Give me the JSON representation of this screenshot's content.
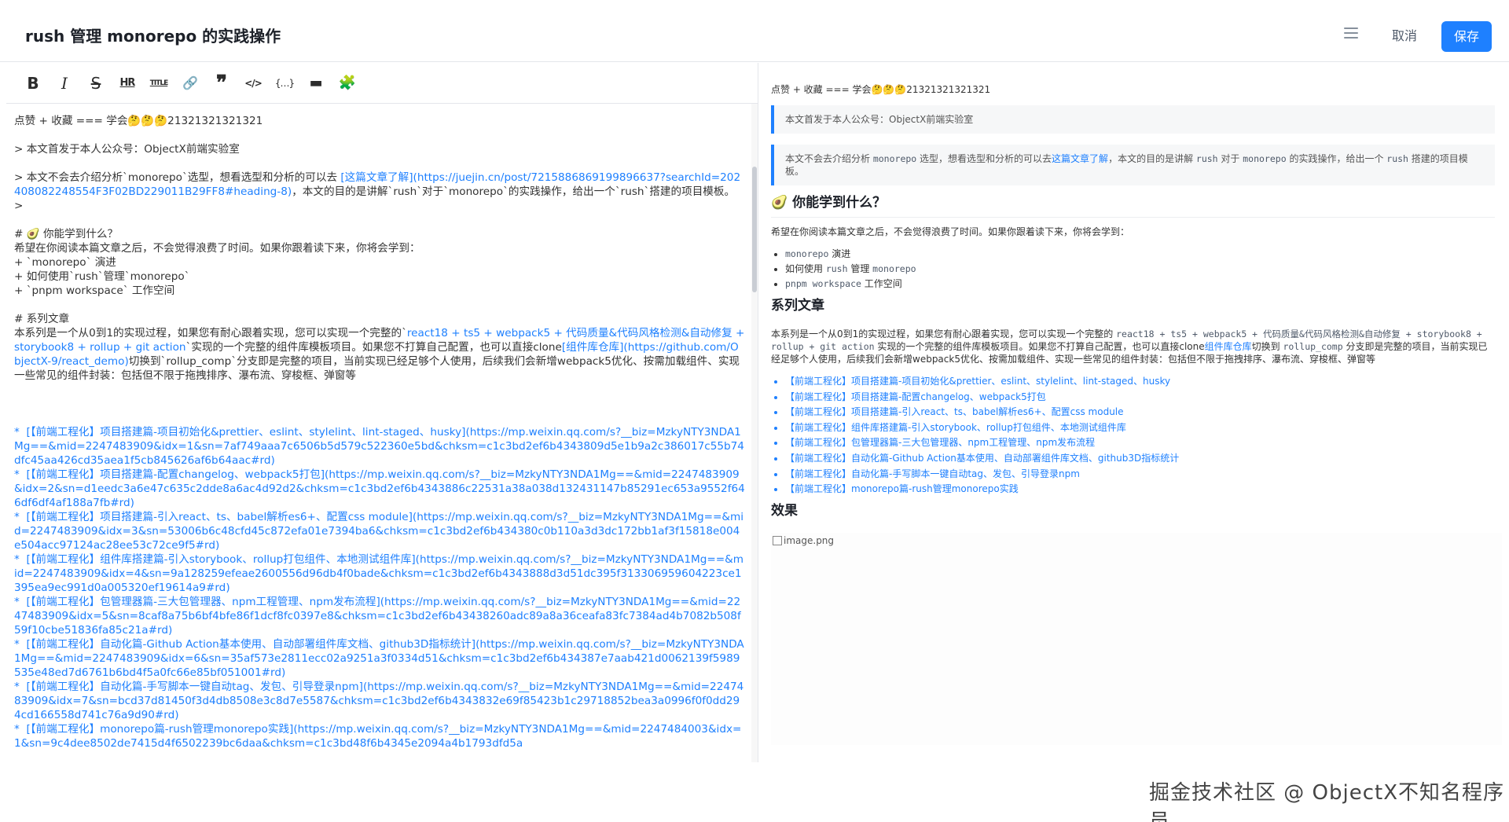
{
  "header": {
    "title": "rush 管理 monorepo 的实践操作",
    "menu_icon": "hamburger-menu-icon",
    "cancel_label": "取消",
    "save_label": "保存",
    "accent_color": "#1e80ff"
  },
  "toolbar": {
    "items": [
      {
        "name": "bold",
        "glyph": "B"
      },
      {
        "name": "italic",
        "glyph": "I"
      },
      {
        "name": "strikethrough",
        "glyph": "S"
      },
      {
        "name": "horizontal-rule",
        "glyph": "HR"
      },
      {
        "name": "title",
        "glyph": "TITLE"
      },
      {
        "name": "link",
        "glyph": "🔗"
      },
      {
        "name": "quote",
        "glyph": "❞"
      },
      {
        "name": "code",
        "glyph": "</>"
      },
      {
        "name": "code-block",
        "glyph": "{…}"
      },
      {
        "name": "image",
        "glyph": "▬"
      },
      {
        "name": "plugin",
        "glyph": "🧩"
      }
    ]
  },
  "editor": {
    "line1": "点赞 + 收藏 === 学会🤔🤔🤔21321321321321",
    "line2": "> 本文首发于本人公众号：ObjectX前端实验室",
    "line3a": "> 本文不会去介绍分析`monorepo`选型，想看选型和分析的可以去 ",
    "line3link": "[这篇文章了解](https://juejin.cn/post/7215886869199896637?searchId=202408082248554F3F02BD229011B29FF8#heading-8)",
    "line3b": "，本文的目的是讲解`rush`对于`monorepo`的实践操作，给出一个`rush`搭建的项目模板。",
    "line4": ">",
    "line5": "# 🥑 你能学到什么？",
    "line6": "希望在你阅读本篇文章之后，不会觉得浪费了时间。如果你跟着读下来，你将会学到：",
    "line7": "+ `monorepo` 演进",
    "line8": "+ 如何使用`rush`管理`monorepo`",
    "line9": "+ `pnpm workspace` 工作空间",
    "line10": "# 系列文章",
    "line11a": "本系列是一个从0到1的实现过程，如果您有耐心跟着实现，您可以实现一个完整的`",
    "line11link": "react18 + ts5 + webpack5 + 代码质量&代码风格检测&自动修复 + storybook8 + rollup + git action",
    "line11b": "`实现的一个完整的组件库模板项目。如果您不打算自己配置，也可以直接clone",
    "line11link2": "[组件库仓库](https://github.com/ObjectX-9/react_demo)",
    "line11c": "切换到`rollup_comp`分支即是完整的项目，当前实现已经足够个人使用，后续我们会新增webpack5优化、按需加载组件、实现一些常见的组件封装：包括但不限于拖拽排序、瀑布流、穿梭框、弹窗等",
    "series": [
      "*  [【前端工程化】项目搭建篇-项目初始化&prettier、eslint、stylelint、lint-staged、husky](https://mp.weixin.qq.com/s?__biz=MzkyNTY3NDA1Mg==&mid=2247483909&idx=1&sn=7af749aaa7c6506b5d579c522360e5bd&chksm=c1c3bd2ef6b4343809d5e1b9a2c386017c55b74dfc45aa426cd35aea1f5cb845626af6b64aac#rd)",
      "*  [【前端工程化】项目搭建篇-配置changelog、webpack5打包](https://mp.weixin.qq.com/s?__biz=MzkyNTY3NDA1Mg==&mid=2247483909&idx=2&sn=d1eedc3a6e47c635c2dde8a6ac4d92d2&chksm=c1c3bd2ef6b4343886c22531a38a038d132431147b85291ec653a9552f646df6df4af188a7fb#rd)",
      "*  [【前端工程化】项目搭建篇-引入react、ts、babel解析es6+、配置css module](https://mp.weixin.qq.com/s?__biz=MzkyNTY3NDA1Mg==&mid=2247483909&idx=3&sn=53006b6c48cfd45c872efa01e7394ba6&chksm=c1c3bd2ef6b434380c0b110a3d3dc172bb1af3f15818e004e504acc97124ac28ee53c72ce9f5#rd)",
      "*  [【前端工程化】组件库搭建篇-引入storybook、rollup打包组件、本地测试组件库](https://mp.weixin.qq.com/s?__biz=MzkyNTY3NDA1Mg==&mid=2247483909&idx=4&sn=9a128259efeae2600556d96db4f0bade&chksm=c1c3bd2ef6b4343888d3d51dc395f313306959604223ce1395ea9ec991d0a005320ef19614a9#rd)",
      "*  [【前端工程化】包管理器篇-三大包管理器、npm工程管理、npm发布流程](https://mp.weixin.qq.com/s?__biz=MzkyNTY3NDA1Mg==&mid=2247483909&idx=5&sn=8caf8a75b6bf4bfe86f1dcf8fc0397e8&chksm=c1c3bd2ef6b43438260adc89a8a36ceafa83fc7384ad4b7082b508f59f10cbe51836fa85c21a#rd)",
      "*  [【前端工程化】自动化篇-Github Action基本使用、自动部署组件库文档、github3D指标统计](https://mp.weixin.qq.com/s?__biz=MzkyNTY3NDA1Mg==&mid=2247483909&idx=6&sn=35af573e2811ecc02a9251a3f0334d51&chksm=c1c3bd2ef6b434387e7aab421d0062139f5989535e48ed7d6761b6bd4f5a0fc66e85bf051001#rd)",
      "*  [【前端工程化】自动化篇-手写脚本一键自动tag、发包、引导登录npm](https://mp.weixin.qq.com/s?__biz=MzkyNTY3NDA1Mg==&mid=2247483909&idx=7&sn=bcd37d81450f3d4db8508e3c8d7e5587&chksm=c1c3bd2ef6b4343832e69f85423b1c29718852bea3a0996f0f0dd294cd166558d741c76a9d90#rd)",
      "*  [【前端工程化】monorepo篇-rush管理monorepo实践](https://mp.weixin.qq.com/s?__biz=MzkyNTY3NDA1Mg==&mid=2247484003&idx=1&sn=9c4dee8502de7415d4f6502239bc6daa&chksm=c1c3bd48f6b4345e2094a4b1793dfd5a"
    ]
  },
  "preview": {
    "p1": "点赞 + 收藏 === 学会🤔🤔🤔21321321321321",
    "quote1": "本文首发于本人公众号：ObjectX前端实验室",
    "quote2a": "本文不会去介绍分析 ",
    "quote2code1": "monorepo",
    "quote2b": " 选型，想看选型和分析的可以去",
    "quote2link": "这篇文章了解",
    "quote2c": "，本文的目的是讲解 ",
    "quote2code2": "rush",
    "quote2d": " 对于 ",
    "quote2code3": "monorepo",
    "quote2e": " 的实践操作，给出一个 ",
    "quote2code4": "rush",
    "quote2f": " 搭建的项目模板。",
    "h_learn": "🥑 你能学到什么？",
    "learn_intro": "希望在你阅读本篇文章之后，不会觉得浪费了时间。如果你跟着读下来，你将会学到：",
    "learn1code": "monorepo",
    "learn1text": " 演进",
    "learn2a": "如何使用 ",
    "learn2code1": "rush",
    "learn2b": " 管理 ",
    "learn2code2": "monorepo",
    "learn3code": "pnpm workspace",
    "learn3text": " 工作空间",
    "h_series": "系列文章",
    "series_intro_a": "本系列是一个从0到1的实现过程，如果您有耐心跟着实现，您可以实现一个完整的 ",
    "series_intro_code": "react18 + ts5 + webpack5 + 代码质量&代码风格检测&自动修复 + storybook8 + rollup + git action",
    "series_intro_b": " 实现的一个完整的组件库模板项目。如果您不打算自己配置，也可以直接clone",
    "series_intro_link": "组件库仓库",
    "series_intro_c": "切换到 ",
    "series_intro_code2": "rollup_comp",
    "series_intro_d": " 分支即是完整的项目，当前实现已经足够个人使用，后续我们会新增webpack5优化、按需加载组件、实现一些常见的组件封装：包括但不限于拖拽排序、瀑布流、穿梭框、弹窗等",
    "series_links": [
      "【前端工程化】项目搭建篇-项目初始化&prettier、eslint、stylelint、lint-staged、husky",
      "【前端工程化】项目搭建篇-配置changelog、webpack5打包",
      "【前端工程化】项目搭建篇-引入react、ts、babel解析es6+、配置css module",
      "【前端工程化】组件库搭建篇-引入storybook、rollup打包组件、本地测试组件库",
      "【前端工程化】包管理器篇-三大包管理器、npm工程管理、npm发布流程",
      "【前端工程化】自动化篇-Github Action基本使用、自动部署组件库文档、github3D指标统计",
      "【前端工程化】自动化篇-手写脚本一键自动tag、发包、引导登录npm",
      "【前端工程化】monorepo篇-rush管理monorepo实践"
    ],
    "h_effect": "效果",
    "image_alt": "image.png"
  },
  "watermark": "掘金技术社区 @ ObjectX不知名程序员"
}
